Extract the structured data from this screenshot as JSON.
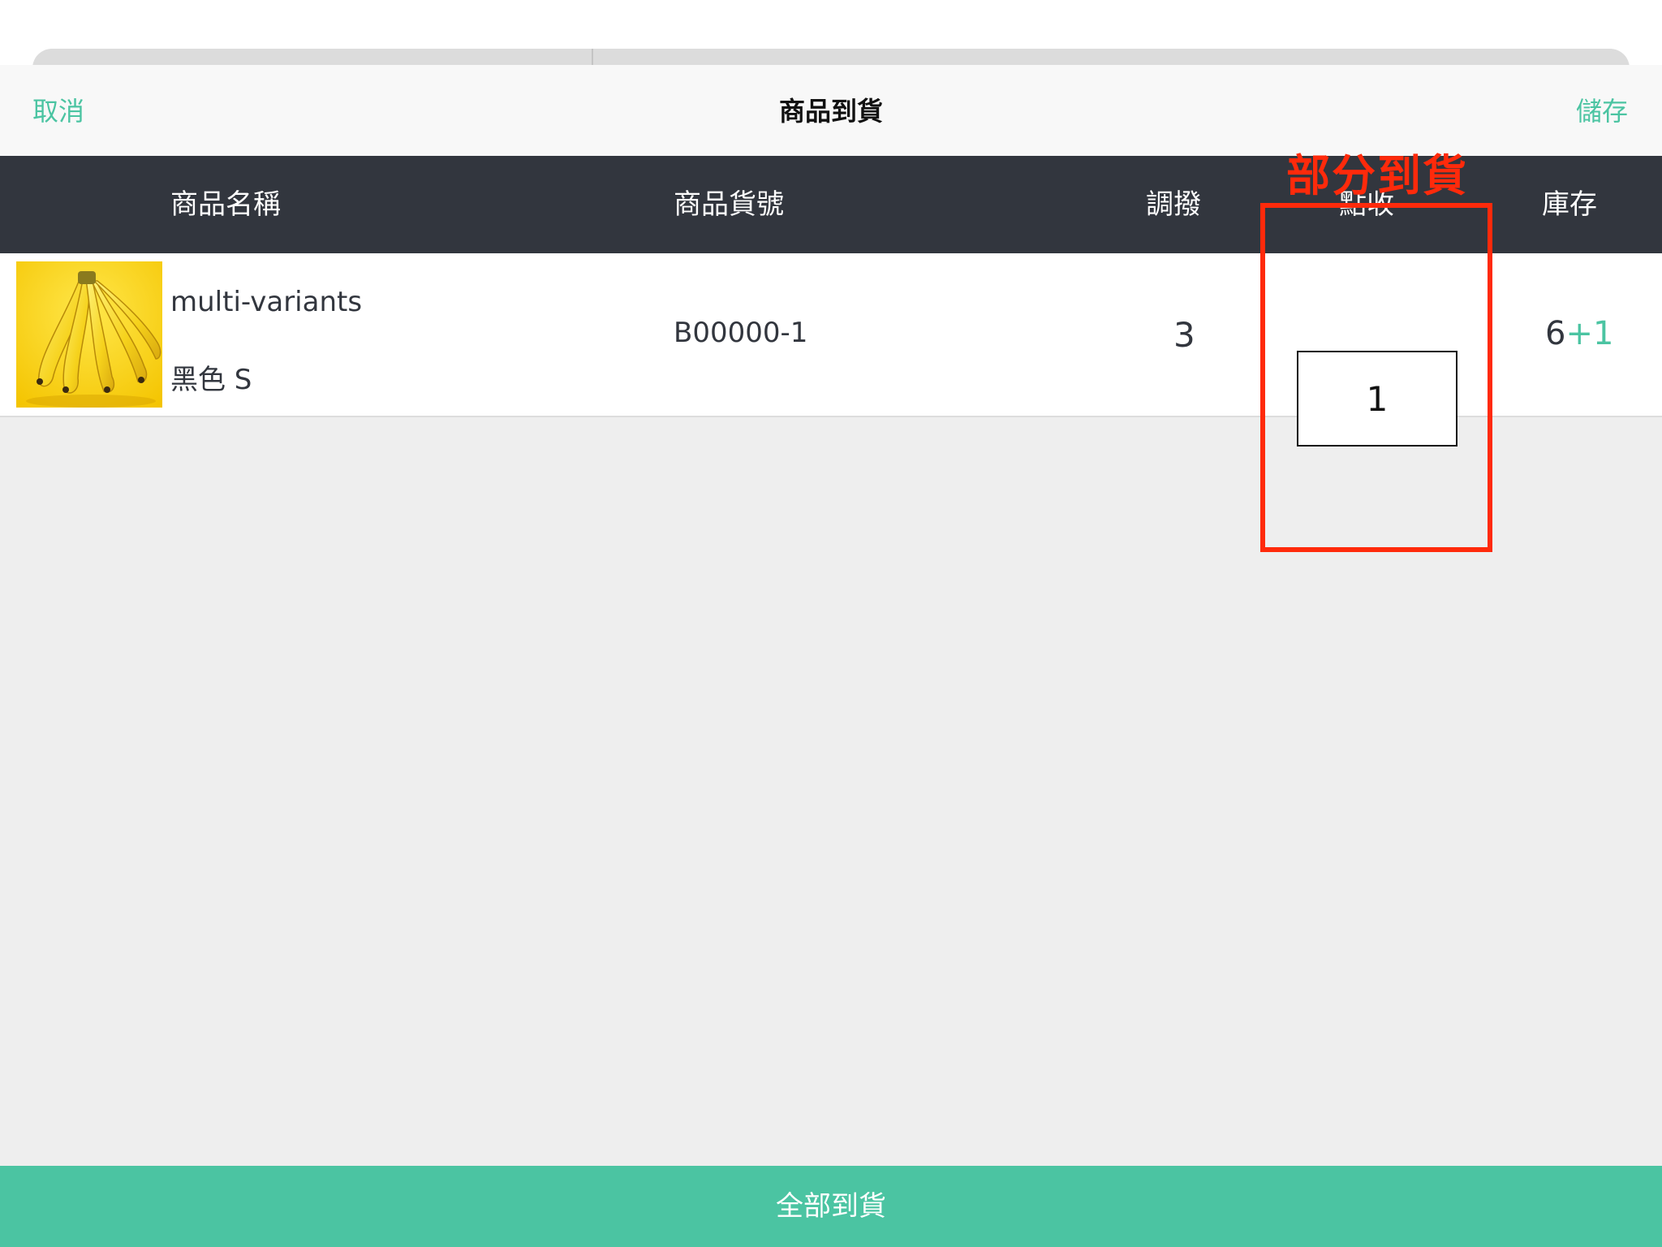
{
  "nav": {
    "cancel_label": "取消",
    "title": "商品到貨",
    "save_label": "儲存"
  },
  "table": {
    "columns": [
      "商品名稱",
      "商品貨號",
      "調撥",
      "點收",
      "庫存"
    ],
    "rows": [
      {
        "name": "multi-variants",
        "variant": "黑色 S",
        "sku": "B00000-1",
        "transfer_qty": "3",
        "receive_qty": "1",
        "stock_base": "6",
        "stock_delta": "+1",
        "thumbnail_icon": "banana-image"
      }
    ]
  },
  "annotation": {
    "label": "部分到貨",
    "color": "#ff2a0b"
  },
  "footer": {
    "all_arrived_label": "全部到貨"
  },
  "colors": {
    "accent": "#4bc4a2",
    "header_bg": "#32363e",
    "body_bg": "#eeeeee"
  }
}
